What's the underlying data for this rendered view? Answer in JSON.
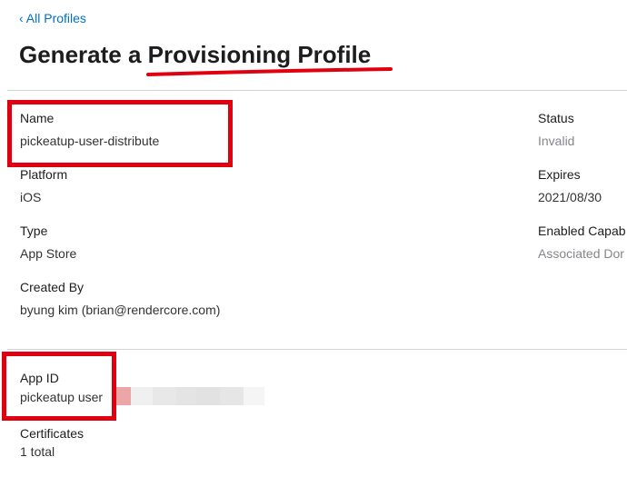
{
  "nav": {
    "back_label": "‹ All Profiles"
  },
  "page": {
    "title": "Generate a Provisioning Profile"
  },
  "details_left": {
    "name": {
      "label": "Name",
      "value": "pickeatup-user-distribute"
    },
    "platform": {
      "label": "Platform",
      "value": "iOS"
    },
    "type": {
      "label": "Type",
      "value": "App Store"
    },
    "created_by": {
      "label": "Created By",
      "value": "byung kim (brian@rendercore.com)"
    }
  },
  "details_right": {
    "status": {
      "label": "Status",
      "value": "Invalid"
    },
    "expires": {
      "label": "Expires",
      "value": "2021/08/30"
    },
    "capabilities": {
      "label": "Enabled Capab",
      "value": "Associated Dor"
    }
  },
  "app_section": {
    "app_id": {
      "label": "App ID",
      "value": "pickeatup user"
    },
    "certificates": {
      "label": "Certificates",
      "value": "1 total"
    }
  },
  "colors": {
    "link": "#0070c9",
    "annotation_red": "#e0000f",
    "muted_text": "#86868b",
    "divider": "#d2d2d7"
  }
}
